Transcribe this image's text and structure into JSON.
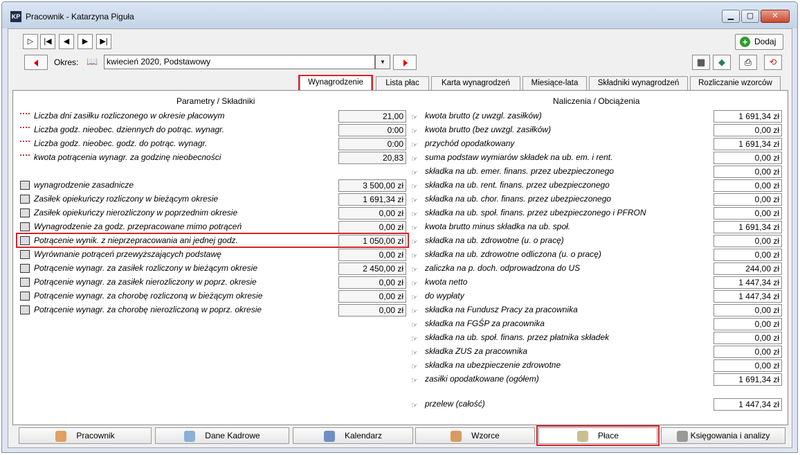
{
  "window": {
    "title": "Pracownik - Katarzyna Piguła"
  },
  "toolbar": {
    "okres_label": "Okres:",
    "okres_value": "kwiecień 2020, Podstawowy",
    "add_label": "Dodaj"
  },
  "tabs": [
    "Wynagrodzenie",
    "Lista płac",
    "Karta wynagrodzeń",
    "Miesiące-lata",
    "Składniki wynagrodzeń",
    "Rozliczanie wzorców"
  ],
  "left": {
    "header": "Parametry / Składniki",
    "params": [
      {
        "label": "Liczba dni zasiłku rozliczonego w okresie płacowym",
        "value": "21,00"
      },
      {
        "label": "Liczba godz. nieobec. dziennych do potrąc. wynagr.",
        "value": "0:00"
      },
      {
        "label": "Liczba godz. nieobec. godz. do potrąc. wynagr.",
        "value": "0:00"
      },
      {
        "label": "kwota potrącenia wynagr. za godzinę nieobecności",
        "value": "20,83"
      }
    ],
    "items": [
      {
        "label": "wynagrodzenie zasadnicze",
        "value": "3 500,00 zł"
      },
      {
        "label": "Zasiłek opiekuńczy rozliczony w bieżącym okresie",
        "value": "1 691,34 zł"
      },
      {
        "label": "Zasiłek opiekuńczy nierozliczony w poprzednim okresie",
        "value": "0,00 zł"
      },
      {
        "label": "Wynagrodzenie za godz. przepracowane mimo potrąceń",
        "value": "0,00 zł"
      },
      {
        "label": "Potrącenie wynik. z nieprzepracowania ani jednej godz.",
        "value": "1 050,00 zł"
      },
      {
        "label": "Wyrównanie potrąceń przewyższających podstawę",
        "value": "0,00 zł"
      },
      {
        "label": "Potrącenie wynagr. za zasiłek rozliczony w bieżącym okresie",
        "value": "2 450,00 zł"
      },
      {
        "label": "Potrącenie wynagr. za zasiłek nierozliczony w poprz. okresie",
        "value": "0,00 zł"
      },
      {
        "label": "Potrącenie wynagr. za chorobę rozliczoną w bieżącym okresie",
        "value": "0,00 zł"
      },
      {
        "label": "Potrącenie wynagr. za chorobę nierozliczoną w poprz. okresie",
        "value": "0,00 zł"
      }
    ]
  },
  "right": {
    "header": "Naliczenia / Obciążenia",
    "items": [
      {
        "label": "kwota brutto (z uwzgl. zasiłków)",
        "value": "1 691,34 zł"
      },
      {
        "label": "kwota brutto (bez uwzgl. zasiłków)",
        "value": "0,00 zł"
      },
      {
        "label": "przychód opodatkowany",
        "value": "1 691,34 zł"
      },
      {
        "label": "suma podstaw wymiarów składek na ub. em. i rent.",
        "value": "0,00 zł"
      },
      {
        "label": "składka na ub. emer. finans. przez ubezpieczonego",
        "value": "0,00 zł"
      },
      {
        "label": "składka na ub. rent. finans. przez ubezpieczonego",
        "value": "0,00 zł"
      },
      {
        "label": "składka na ub. chor. finans. przez ubezpieczonego",
        "value": "0,00 zł"
      },
      {
        "label": "składka na ub. społ. finans. przez ubezpieczonego i PFRON",
        "value": "0,00 zł"
      },
      {
        "label": "kwota brutto minus składka na ub. społ.",
        "value": "1 691,34 zł"
      },
      {
        "label": "składka na ub. zdrowotne (u. o pracę)",
        "value": "0,00 zł"
      },
      {
        "label": "składka na ub. zdrowotne odliczona (u. o pracę)",
        "value": "0,00 zł"
      },
      {
        "label": "zaliczka na p. doch. odprowadzona do US",
        "value": "244,00 zł"
      },
      {
        "label": "kwota netto",
        "value": "1 447,34 zł"
      },
      {
        "label": "do wypłaty",
        "value": "1 447,34 zł"
      },
      {
        "label": "składka na Fundusz Pracy za pracownika",
        "value": "0,00 zł"
      },
      {
        "label": "składka na FGŚP za pracownika",
        "value": "0,00 zł"
      },
      {
        "label": "składka na ub. społ. finans. przez płatnika składek",
        "value": "0,00 zł"
      },
      {
        "label": "składka ZUS za pracownika",
        "value": "0,00 zł"
      },
      {
        "label": "składka na ubezpieczenie zdrowotne",
        "value": "0,00 zł"
      },
      {
        "label": "zasiłki opodatkowane (ogółem)",
        "value": "1 691,34 zł"
      }
    ],
    "total": {
      "label": "przelew (całość)",
      "value": "1 447,34 zł"
    }
  },
  "bottom_tabs": [
    "Pracownik",
    "Dane Kadrowe",
    "Kalendarz",
    "Wzorce",
    "Płace",
    "Księgowania i analizy"
  ]
}
